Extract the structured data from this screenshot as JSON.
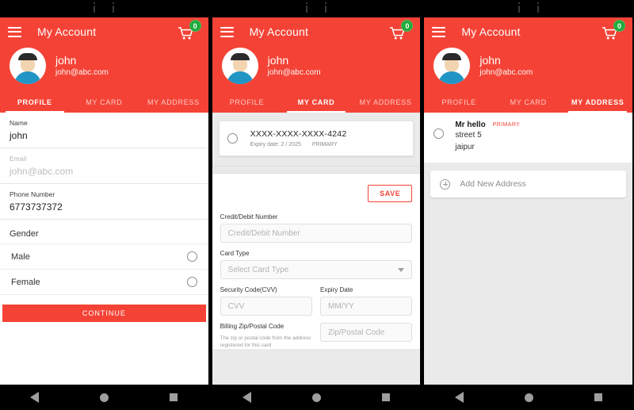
{
  "app": {
    "title": "My Account",
    "brand_color": "#F44336",
    "badge_color": "#1faa39",
    "menu_icon": "hamburger-icon",
    "cart_icon": "shopping-cart-icon",
    "cart_count": "0"
  },
  "user": {
    "name": "john",
    "email": "john@abc.com",
    "avatar_icon": "user-avatar-icon"
  },
  "tabs": [
    {
      "label": "PROFILE"
    },
    {
      "label": "MY CARD"
    },
    {
      "label": "MY ADDRESS"
    }
  ],
  "profile_panel": {
    "active_tab": "PROFILE",
    "fields": [
      {
        "label": "Name",
        "value": "john",
        "dim": false
      },
      {
        "label": "Email",
        "value": "john@abc.com",
        "dim": true
      },
      {
        "label": "Phone Number",
        "value": "6773737372",
        "dim": false
      }
    ],
    "gender_label": "Gender",
    "gender_options": [
      {
        "label": "Male",
        "selected": false
      },
      {
        "label": "Female",
        "selected": false
      }
    ],
    "continue_label": "CONTINUE"
  },
  "card_panel": {
    "active_tab": "MY CARD",
    "saved_card": {
      "number": "XXXX-XXXX-XXXX-4242",
      "expiry": "Expiry date: 2 / 2025",
      "badge": "PRIMARY",
      "selected": false
    },
    "save_label": "SAVE",
    "form": {
      "number_label": "Credit/Debit Number",
      "number_placeholder": "Credit/Debit Number",
      "type_label": "Card Type",
      "type_placeholder": "Select Card Type",
      "cvv_label": "Security Code(CVV)",
      "cvv_placeholder": "CVV",
      "expiry_label": "Expiry Date",
      "expiry_placeholder": "MM/YY",
      "zip_label": "Billing Zip/Postal Code",
      "zip_placeholder": "Zip/Postal Code",
      "zip_hint": "The zip or postal code from the address registered for this card"
    }
  },
  "address_panel": {
    "active_tab": "MY ADDRESS",
    "address": {
      "name": "Mr hello",
      "badge": "PRIMARY",
      "line1": "street 5",
      "line2": "jaipur",
      "selected": false
    },
    "add_new_label": "Add New Address",
    "add_new_icon": "plus-circle-icon"
  },
  "navbar": {
    "back_icon": "back-triangle-icon",
    "home_icon": "home-circle-icon",
    "recents_icon": "recents-square-icon"
  }
}
